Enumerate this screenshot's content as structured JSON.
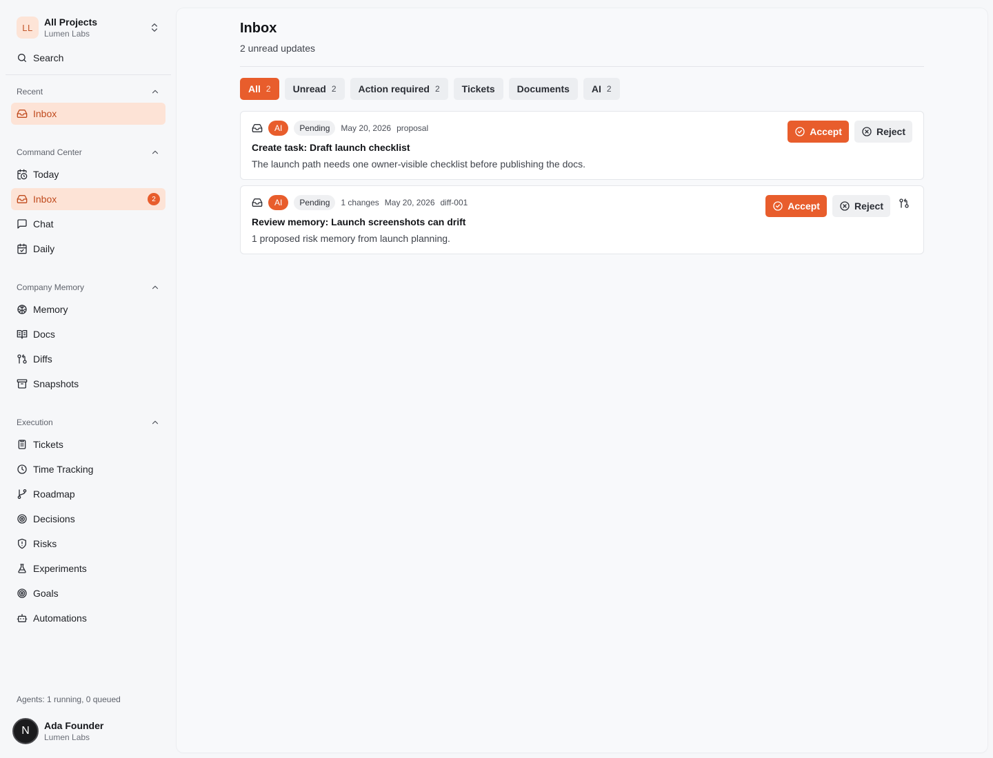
{
  "workspace": {
    "initials": "LL",
    "title": "All Projects",
    "subtitle": "Lumen Labs"
  },
  "search": {
    "label": "Search"
  },
  "sections": {
    "recent": {
      "title": "Recent",
      "items": [
        {
          "label": "Inbox",
          "icon": "inbox-icon"
        }
      ]
    },
    "command_center": {
      "title": "Command Center",
      "items": [
        {
          "label": "Today",
          "icon": "calendar-clock-icon"
        },
        {
          "label": "Inbox",
          "icon": "inbox-icon",
          "badge": "2"
        },
        {
          "label": "Chat",
          "icon": "chat-icon"
        },
        {
          "label": "Daily",
          "icon": "calendar-check-icon"
        }
      ]
    },
    "company_memory": {
      "title": "Company Memory",
      "items": [
        {
          "label": "Memory",
          "icon": "brain-icon"
        },
        {
          "label": "Docs",
          "icon": "book-icon"
        },
        {
          "label": "Diffs",
          "icon": "git-compare-icon"
        },
        {
          "label": "Snapshots",
          "icon": "archive-icon"
        }
      ]
    },
    "execution": {
      "title": "Execution",
      "items": [
        {
          "label": "Tickets",
          "icon": "clipboard-icon"
        },
        {
          "label": "Time Tracking",
          "icon": "clock-icon"
        },
        {
          "label": "Roadmap",
          "icon": "git-branch-icon"
        },
        {
          "label": "Decisions",
          "icon": "target-icon"
        },
        {
          "label": "Risks",
          "icon": "shield-alert-icon"
        },
        {
          "label": "Experiments",
          "icon": "flask-icon"
        },
        {
          "label": "Goals",
          "icon": "goal-icon"
        },
        {
          "label": "Automations",
          "icon": "bot-icon"
        }
      ]
    }
  },
  "agents_status": "Agents: 1 running, 0 queued",
  "user": {
    "initial": "N",
    "name": "Ada Founder",
    "org": "Lumen Labs"
  },
  "page": {
    "title": "Inbox",
    "subtitle": "2 unread updates"
  },
  "tabs": [
    {
      "label": "All",
      "count": "2",
      "active": true
    },
    {
      "label": "Unread",
      "count": "2"
    },
    {
      "label": "Action required",
      "count": "2"
    },
    {
      "label": "Tickets",
      "count": ""
    },
    {
      "label": "Documents",
      "count": ""
    },
    {
      "label": "AI",
      "count": "2"
    }
  ],
  "cards": [
    {
      "source_badge": "AI",
      "status": "Pending",
      "changes": "",
      "date": "May 20, 2026",
      "ref": "proposal",
      "title": "Create task: Draft launch checklist",
      "description": "The launch path needs one owner-visible checklist before publishing the docs.",
      "accept_label": "Accept",
      "reject_label": "Reject"
    },
    {
      "source_badge": "AI",
      "status": "Pending",
      "changes": "1 changes",
      "date": "May 20, 2026",
      "ref": "diff-001",
      "title": "Review memory: Launch screenshots can drift",
      "description": "1 proposed risk memory from launch planning.",
      "accept_label": "Accept",
      "reject_label": "Reject"
    }
  ],
  "colors": {
    "accent": "#e85d2c",
    "accent_soft": "#fde3d6",
    "background": "#f6f7f9"
  }
}
